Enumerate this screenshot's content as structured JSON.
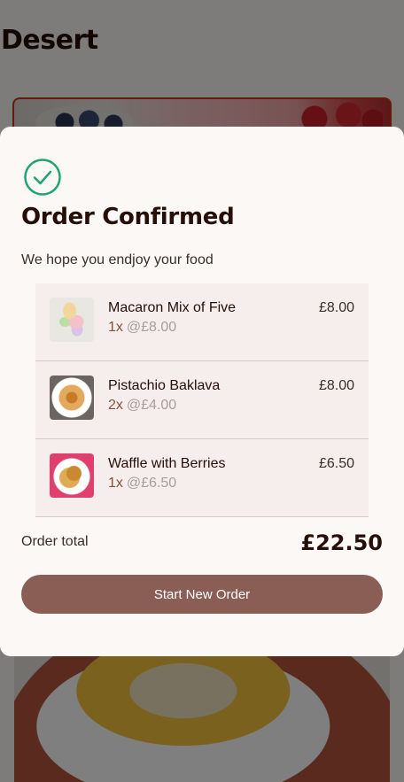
{
  "background": {
    "page_title": "Desert"
  },
  "modal": {
    "icon": "check-circle-icon",
    "title": "Order Confirmed",
    "subtitle": "We hope you endjoy your food",
    "items": [
      {
        "name": "Macaron Mix of Five",
        "quantity": "1x",
        "unit_price": "@£8.00",
        "total": "£8.00"
      },
      {
        "name": "Pistachio Baklava",
        "quantity": "2x",
        "unit_price": "@£4.00",
        "total": "£8.00"
      },
      {
        "name": "Waffle with Berries",
        "quantity": "1x",
        "unit_price": "@£6.50",
        "total": "£6.50"
      }
    ],
    "total_label": "Order total",
    "total_value": "£22.50",
    "button_label": "Start New Order"
  },
  "colors": {
    "accent": "#8a5e55",
    "success": "#1ea575",
    "text_dark": "#260f08"
  }
}
